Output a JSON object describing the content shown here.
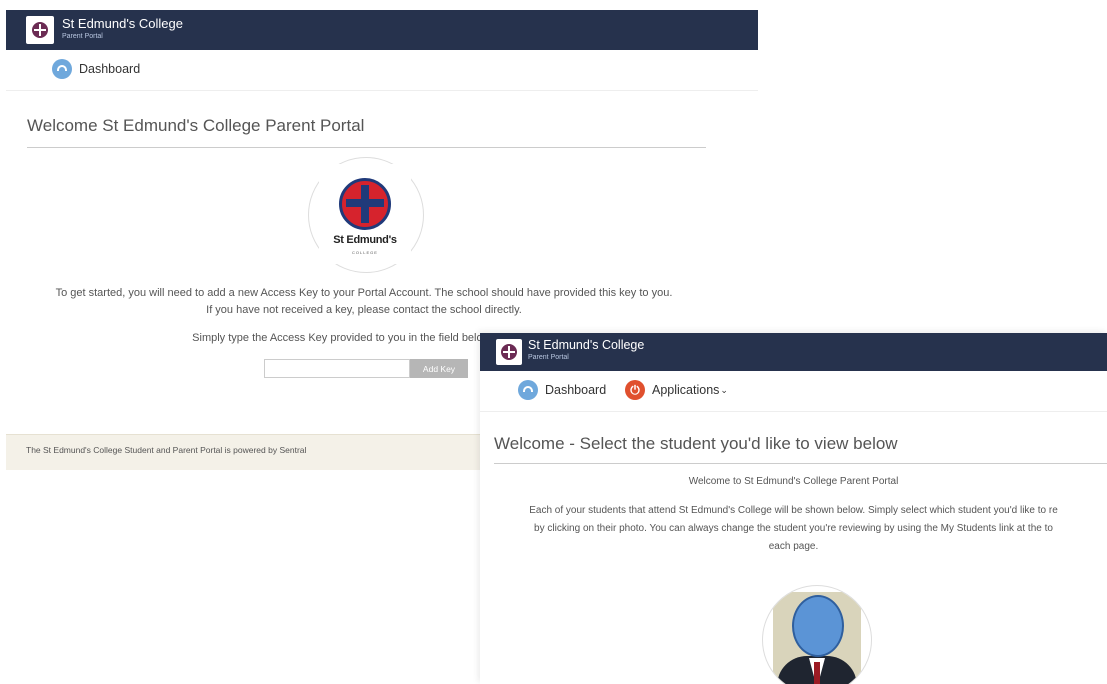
{
  "portal_setup": {
    "header": {
      "title": "St Edmund's College",
      "subtitle": "Parent Portal"
    },
    "nav": {
      "dashboard": "Dashboard"
    },
    "page_title": "Welcome St Edmund's College Parent Portal",
    "crest": {
      "name": "St Edmund's",
      "college": "COLLEGE"
    },
    "intro_line1": "To get started, you will need to add a new Access Key to your Portal Account. The school should have provided this key to you.",
    "intro_line2": "If you have not received a key, please contact the school directly.",
    "instruction": "Simply type the Access Key provided to you in the field below to add it.",
    "access_key_input": {
      "value": "",
      "placeholder": ""
    },
    "add_key_label": "Add Key",
    "footer_text": "The St Edmund's College Student and Parent Portal is powered by Sentral"
  },
  "portal_select": {
    "header": {
      "title": "St Edmund's College",
      "subtitle": "Parent Portal"
    },
    "nav": {
      "dashboard": "Dashboard",
      "applications": "Applications"
    },
    "page_title": "Welcome - Select the student you'd like to view below",
    "welcome_text": "Welcome to St Edmund's College Parent Portal",
    "desc_line1": "Each of your students that attend St Edmund's College will be shown below. Simply select which student you'd like to re",
    "desc_line2": "by clicking on their photo. You can always change the student you're reviewing by using the My Students link at the to",
    "desc_line3": "each page."
  },
  "icons": [
    "school-logo-icon",
    "dashboard-icon",
    "applications-power-icon",
    "chevron-down-icon"
  ],
  "colors": {
    "header_bg": "#26324d",
    "dashboard_icon": "#6fa8dc",
    "applications_icon": "#e0502e",
    "footer_bg": "#f4f1e8"
  }
}
